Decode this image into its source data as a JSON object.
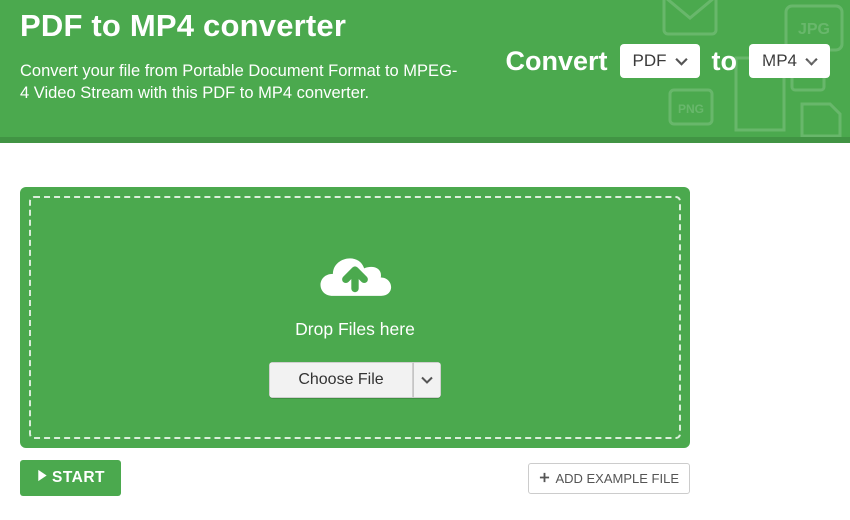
{
  "header": {
    "title": "PDF to MP4 converter",
    "subtitle": "Convert your file from Portable Document Format to MPEG-4 Video Stream with this PDF to MP4 converter.",
    "convert_label": "Convert",
    "to_label": "to",
    "from_format": "PDF",
    "to_format": "MP4"
  },
  "dropzone": {
    "drop_text": "Drop Files here",
    "choose_file_label": "Choose File"
  },
  "actions": {
    "start_label": "START",
    "add_example_label": "ADD EXAMPLE FILE"
  },
  "icons": {
    "cloud_upload": "cloud-upload-icon",
    "chevron_down": "chevron-down-icon",
    "play": "play-icon",
    "plus": "plus-icon"
  },
  "bg_file_labels": [
    "JPG",
    "PNG"
  ]
}
